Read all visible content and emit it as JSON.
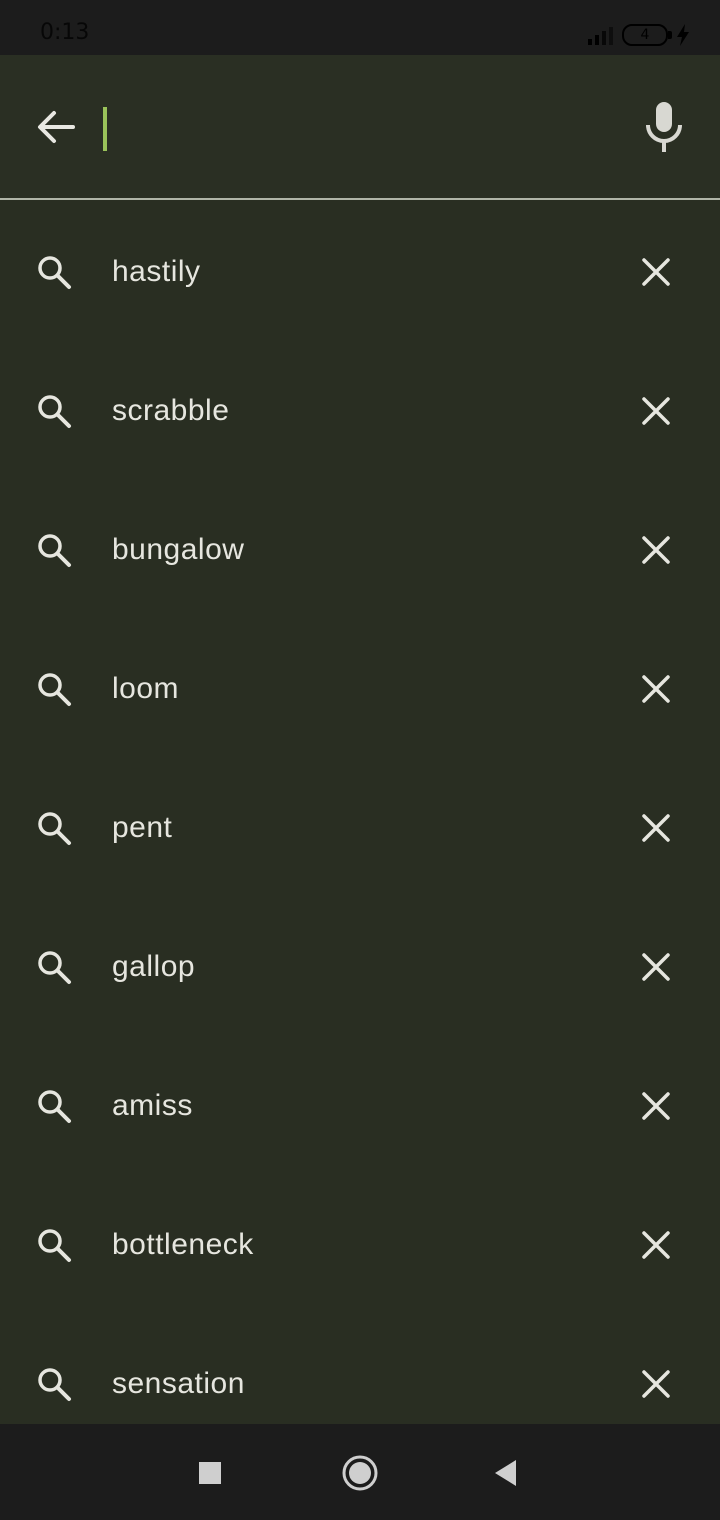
{
  "status_bar": {
    "time": "0:13",
    "battery_level": "4"
  },
  "search": {
    "value": "",
    "placeholder": ""
  },
  "icons": {
    "back": "arrow-left-icon",
    "mic": "microphone-icon",
    "search": "search-icon",
    "remove": "close-icon",
    "nav_recents": "square-icon",
    "nav_home": "circle-icon",
    "nav_back": "triangle-back-icon"
  },
  "colors": {
    "background": "#292e22",
    "accent_caret": "#9ac35a",
    "text": "#e6e6df",
    "system_bar": "#1c1c1c"
  },
  "suggestions": [
    {
      "label": "hastily"
    },
    {
      "label": "scrabble"
    },
    {
      "label": "bungalow"
    },
    {
      "label": "loom"
    },
    {
      "label": "pent"
    },
    {
      "label": "gallop"
    },
    {
      "label": "amiss"
    },
    {
      "label": "bottleneck"
    },
    {
      "label": "sensation"
    }
  ]
}
